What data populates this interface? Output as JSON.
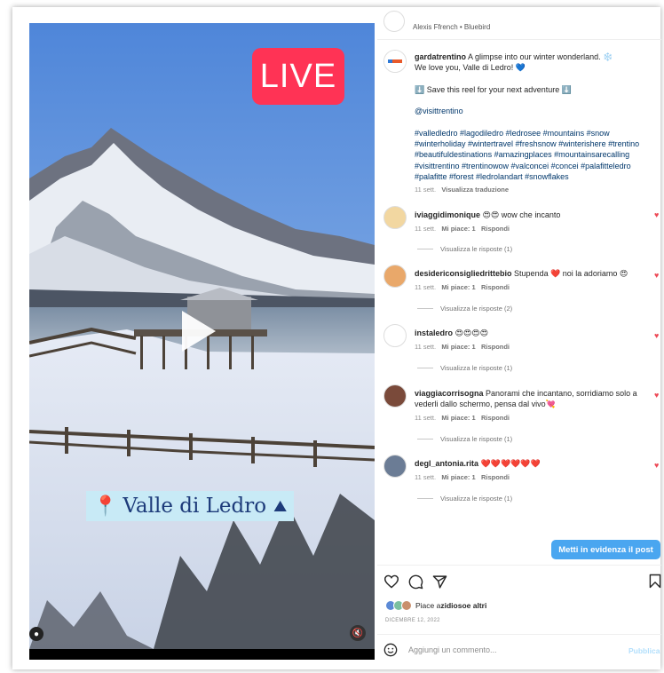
{
  "media": {
    "live_label": "LIVE",
    "place_label": "Valle di Ledro",
    "pin_icon": "📍",
    "mountain_icon": "⛰"
  },
  "header": {
    "audio_line": "Alexis Ffrench • Bluebird"
  },
  "caption": {
    "username": "gardatrentino",
    "text_line1": "A glimpse into our winter wonderland. ❄️",
    "text_line2": "We love you, Valle di Ledro! 💙",
    "save_line": "⬇️ Save this reel for your next adventure ⬇️",
    "mention": "@visittrentino",
    "hashtags": "#valledledro #lagodiledro #ledrosee #mountains #snow #winterholiday #wintertravel #freshsnow #winterishere #trentino #beautifuldestinations #amazingplaces #mountainsarecalling #visittrentino #trentinowow #valconcei #concei #palafitteledro #palafitte #forest #ledrolandart #snowflakes",
    "time": "11 sett.",
    "translate": "Visualizza traduzione"
  },
  "comments": [
    {
      "user": "iviaggidimonique",
      "text": "😍😍 wow che incanto",
      "time": "11 sett.",
      "likes": "Mi piace: 1",
      "reply": "Rispondi",
      "view_replies": "Visualizza le risposte (1)"
    },
    {
      "user": "desidericonsigliedrittebio",
      "text": "Stupenda ❤️ noi la adoriamo 😍",
      "time": "11 sett.",
      "likes": "Mi piace: 1",
      "reply": "Rispondi",
      "view_replies": "Visualizza le risposte (2)"
    },
    {
      "user": "instaledro",
      "text": "😍😍😍😍",
      "time": "11 sett.",
      "likes": "Mi piace: 1",
      "reply": "Rispondi",
      "view_replies": "Visualizza le risposte (1)"
    },
    {
      "user": "viaggiacorrisogna",
      "text": "Panorami che incantano, sorridiamo solo a vederli dallo schermo, pensa dal vivo💘",
      "time": "11 sett.",
      "likes": "Mi piace: 1",
      "reply": "Rispondi",
      "view_replies": "Visualizza le risposte (1)"
    },
    {
      "user": "degl_antonia.rita",
      "text": "❤️❤️❤️❤️❤️❤️",
      "time": "11 sett.",
      "likes": "Mi piace: 1",
      "reply": "Rispondi",
      "view_replies": "Visualizza le risposte (1)"
    }
  ],
  "feature_button": "Metti in evidenza il post",
  "likes_line": {
    "prefix": "Piace a ",
    "user": "zidioso",
    "suffix": " e altri"
  },
  "date": "DICEMBRE 12, 2022",
  "add_comment": {
    "placeholder": "Aggiungi un commento...",
    "publish": "Pubblica"
  },
  "colors": {
    "live": "#ff3355",
    "feature_button": "#4aa6f0",
    "like_heart": "#ed4956",
    "hashtag": "#00376b"
  }
}
